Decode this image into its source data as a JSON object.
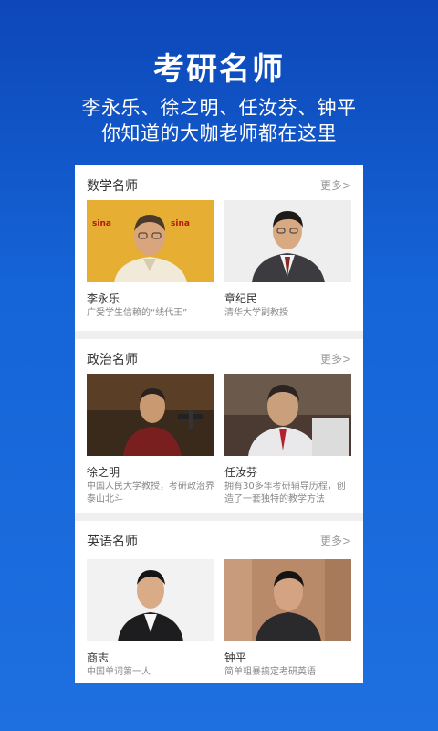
{
  "hero": {
    "title": "考研名师",
    "subtitle_line1": "李永乐、徐之明、任汝芬、钟平",
    "subtitle_line2": "你知道的大咖老师都在这里"
  },
  "sections": [
    {
      "title": "数学名师",
      "more": "更多>",
      "teachers": [
        {
          "name": "李永乐",
          "desc": "广受学生信赖的“线代王”",
          "photo_icon": "portrait-photo",
          "watermark": "sina"
        },
        {
          "name": "章纪民",
          "desc": "清华大学副教授",
          "photo_icon": "portrait-photo"
        }
      ]
    },
    {
      "title": "政治名师",
      "more": "更多>",
      "teachers": [
        {
          "name": "徐之明",
          "desc": "中国人民大学教授，考研政治界泰山北斗",
          "photo_icon": "portrait-photo"
        },
        {
          "name": "任汝芬",
          "desc": "拥有30多年考研辅导历程，创造了一套独特的教学方法",
          "photo_icon": "portrait-photo"
        }
      ]
    },
    {
      "title": "英语名师",
      "more": "更多>",
      "teachers": [
        {
          "name": "商志",
          "desc": "中国单词第一人",
          "photo_icon": "portrait-photo"
        },
        {
          "name": "钟平",
          "desc": "简单粗暴搞定考研英语",
          "photo_icon": "portrait-photo"
        }
      ]
    }
  ]
}
